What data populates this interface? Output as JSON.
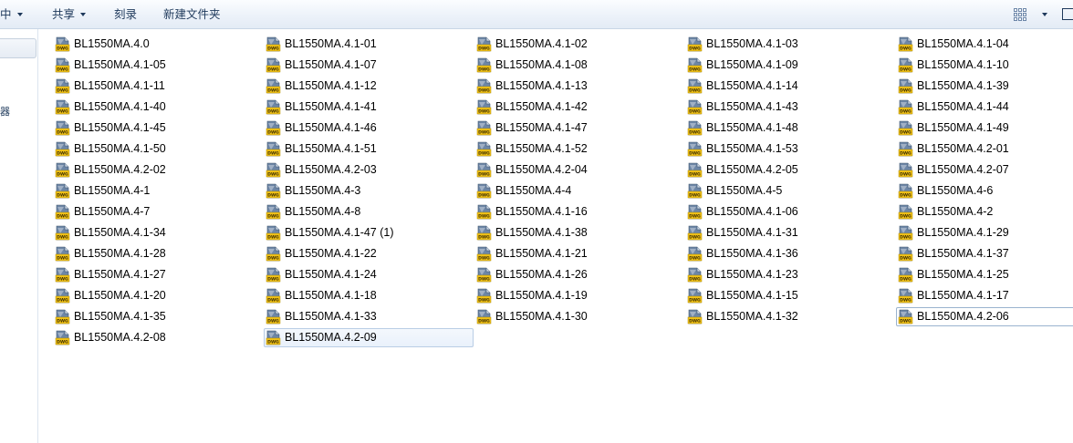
{
  "toolbar": {
    "organize_label": "中",
    "share_label": "共享",
    "burn_label": "刻录",
    "new_folder_label": "新建文件夹"
  },
  "nav": {
    "glyph": "器"
  },
  "icon": {
    "type_label": "DWG",
    "accent": "#f2c318",
    "base": "#6d86a6"
  },
  "files": [
    "BL1550MA.4.0",
    "BL1550MA.4.1-01",
    "BL1550MA.4.1-02",
    "BL1550MA.4.1-03",
    "BL1550MA.4.1-04",
    "BL1550MA.4.1-05",
    "BL1550MA.4.1-07",
    "BL1550MA.4.1-08",
    "BL1550MA.4.1-09",
    "BL1550MA.4.1-10",
    "BL1550MA.4.1-11",
    "BL1550MA.4.1-12",
    "BL1550MA.4.1-13",
    "BL1550MA.4.1-14",
    "BL1550MA.4.1-39",
    "BL1550MA.4.1-40",
    "BL1550MA.4.1-41",
    "BL1550MA.4.1-42",
    "BL1550MA.4.1-43",
    "BL1550MA.4.1-44",
    "BL1550MA.4.1-45",
    "BL1550MA.4.1-46",
    "BL1550MA.4.1-47",
    "BL1550MA.4.1-48",
    "BL1550MA.4.1-49",
    "BL1550MA.4.1-50",
    "BL1550MA.4.1-51",
    "BL1550MA.4.1-52",
    "BL1550MA.4.1-53",
    "BL1550MA.4.2-01",
    "BL1550MA.4.2-02",
    "BL1550MA.4.2-03",
    "BL1550MA.4.2-04",
    "BL1550MA.4.2-05",
    "BL1550MA.4.2-07",
    "BL1550MA.4-1",
    "BL1550MA.4-3",
    "BL1550MA.4-4",
    "BL1550MA.4-5",
    "BL1550MA.4-6",
    "BL1550MA.4-7",
    "BL1550MA.4-8",
    "BL1550MA.4.1-16",
    "BL1550MA.4.1-06",
    "BL1550MA.4-2",
    "BL1550MA.4.1-34",
    "BL1550MA.4.1-47 (1)",
    "BL1550MA.4.1-38",
    "BL1550MA.4.1-31",
    "BL1550MA.4.1-29",
    "BL1550MA.4.1-28",
    "BL1550MA.4.1-22",
    "BL1550MA.4.1-21",
    "BL1550MA.4.1-36",
    "BL1550MA.4.1-37",
    "BL1550MA.4.1-27",
    "BL1550MA.4.1-24",
    "BL1550MA.4.1-26",
    "BL1550MA.4.1-23",
    "BL1550MA.4.1-25",
    "BL1550MA.4.1-20",
    "BL1550MA.4.1-18",
    "BL1550MA.4.1-19",
    "BL1550MA.4.1-15",
    "BL1550MA.4.1-17",
    "BL1550MA.4.1-35",
    "BL1550MA.4.1-33",
    "BL1550MA.4.1-30",
    "BL1550MA.4.1-32",
    "BL1550MA.4.2-06",
    "BL1550MA.4.2-08",
    "BL1550MA.4.2-09"
  ],
  "focused_file": "BL1550MA.4.2-06",
  "selected_file": "BL1550MA.4.2-09"
}
